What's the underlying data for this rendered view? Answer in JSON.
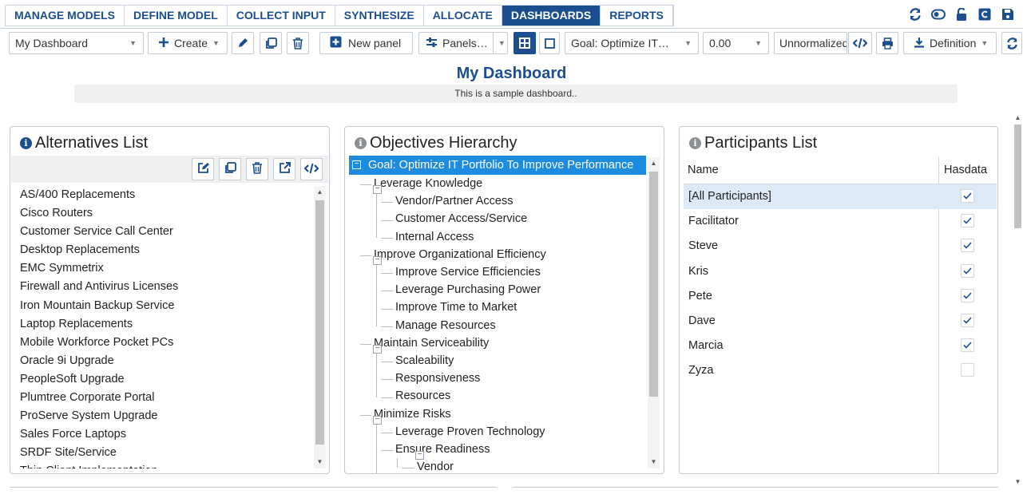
{
  "nav": {
    "tabs": [
      {
        "label": "MANAGE MODELS"
      },
      {
        "label": "DEFINE MODEL"
      },
      {
        "label": "COLLECT INPUT"
      },
      {
        "label": "SYNTHESIZE"
      },
      {
        "label": "ALLOCATE"
      },
      {
        "label": "DASHBOARDS",
        "active": true
      },
      {
        "label": "REPORTS"
      }
    ],
    "icons": [
      "refresh-icon",
      "toggle-icon",
      "unlock-icon",
      "capture-icon",
      "save-icon"
    ]
  },
  "toolbar": {
    "dashboard_select": "My Dashboard",
    "create_label": "Create",
    "new_panel_label": "New panel",
    "panels_label": "Panels…",
    "goal_select": "Goal: Optimize IT…",
    "number_select": "0.00",
    "normalization_select": "Unnormalized",
    "definition_label": "Definition"
  },
  "dashboard": {
    "title": "My Dashboard",
    "subtitle": "This is a sample dashboard.."
  },
  "alternatives": {
    "title": "Alternatives List",
    "items": [
      "AS/400 Replacements",
      "Cisco Routers",
      "Customer Service Call Center",
      "Desktop Replacements",
      "EMC Symmetrix",
      "Firewall and Antivirus Licenses",
      "Iron Mountain Backup Service",
      "Laptop Replacements",
      "Mobile Workforce Pocket PCs",
      "Oracle 9i Upgrade",
      "PeopleSoft Upgrade",
      "Plumtree Corporate Portal",
      "ProServe System Upgrade",
      "Sales Force Laptops",
      "SRDF Site/Service",
      "Thin Client Implementation"
    ]
  },
  "objectives": {
    "title": "Objectives Hierarchy",
    "root": "Goal: Optimize IT Portfolio To Improve Performance",
    "nodes": [
      {
        "label": "Leverage Knowledge"
      },
      {
        "label": "Vendor/Partner Access"
      },
      {
        "label": "Customer Access/Service"
      },
      {
        "label": "Internal Access"
      },
      {
        "label": "Improve Organizational Efficiency"
      },
      {
        "label": "Improve Service Efficiencies"
      },
      {
        "label": "Leverage Purchasing Power"
      },
      {
        "label": "Improve Time to Market"
      },
      {
        "label": "Manage Resources"
      },
      {
        "label": "Maintain Serviceability"
      },
      {
        "label": "Scaleability"
      },
      {
        "label": "Responsiveness"
      },
      {
        "label": "Resources"
      },
      {
        "label": "Minimize Risks"
      },
      {
        "label": "Leverage Proven Technology"
      },
      {
        "label": "Ensure Readiness"
      },
      {
        "label": "Vendor"
      }
    ]
  },
  "participants": {
    "title": "Participants List",
    "columns": {
      "name": "Name",
      "hasdata": "Hasdata"
    },
    "rows": [
      {
        "name": "[All Participants]",
        "hasdata": true,
        "selected": true
      },
      {
        "name": "Facilitator",
        "hasdata": true
      },
      {
        "name": "Steve",
        "hasdata": true
      },
      {
        "name": "Kris",
        "hasdata": true
      },
      {
        "name": "Pete",
        "hasdata": true
      },
      {
        "name": "Dave",
        "hasdata": true
      },
      {
        "name": "Marcia",
        "hasdata": true
      },
      {
        "name": "Zyza",
        "hasdata": false
      }
    ]
  },
  "colors": {
    "brand": "#1a4e8e",
    "selection": "#1d8ce0",
    "row_selected": "#dbeaf6"
  }
}
